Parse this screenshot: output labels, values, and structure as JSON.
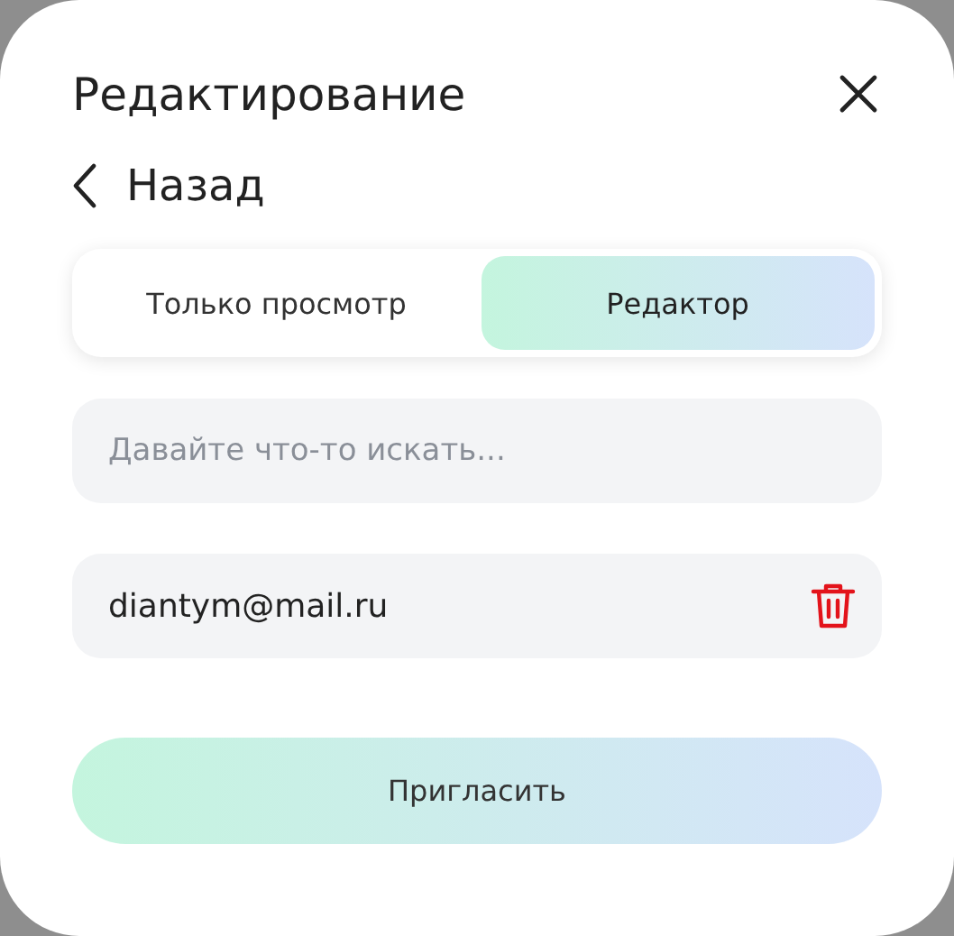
{
  "dialog": {
    "title": "Редактирование",
    "back": "Назад"
  },
  "tabs": [
    {
      "label": "Только просмотр",
      "selected": false
    },
    {
      "label": "Редактор",
      "selected": true
    }
  ],
  "search": {
    "placeholder": "Давайте что-то искать..."
  },
  "invitees": [
    {
      "email": "diantym@mail.ru"
    }
  ],
  "invite_button": "Пригласить"
}
